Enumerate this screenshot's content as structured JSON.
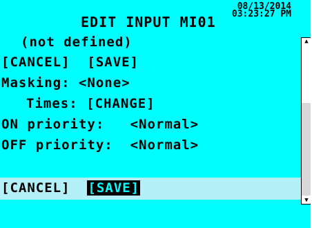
{
  "header": {
    "date": "08/13/2014",
    "time": "03:23:27 PM",
    "title": "EDIT INPUT MI01"
  },
  "input_name": "(not defined)",
  "top_actions": {
    "cancel_label": "[CANCEL]",
    "save_label": "[SAVE]"
  },
  "masking": {
    "label": "Masking:",
    "value": "<None>"
  },
  "times": {
    "label": "Times:",
    "action": "[CHANGE]"
  },
  "on_priority": {
    "label": "ON priority:",
    "value": "<Normal>"
  },
  "off_priority": {
    "label": "OFF priority:",
    "value": "<Normal>"
  },
  "bottom_actions": {
    "cancel_label": "[CANCEL]",
    "save_label": "[SAVE]"
  },
  "colors": {
    "screen_bg": "#00fefe",
    "selected_row_bg": "#b4f0f8",
    "text": "#000000"
  },
  "icons": {
    "scroll_up": "up-arrow-icon",
    "scroll_down": "down-arrow-icon"
  }
}
